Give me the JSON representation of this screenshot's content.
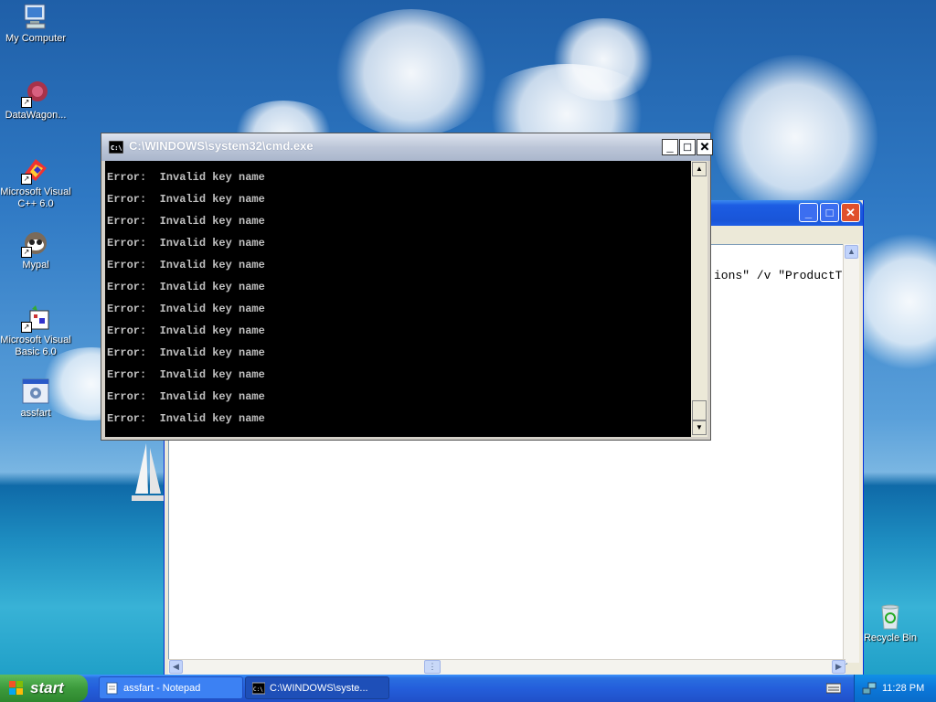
{
  "desktop": {
    "icons": [
      {
        "label": "My Computer"
      },
      {
        "label": "DataWagon..."
      },
      {
        "label": "Microsoft Visual C++ 6.0"
      },
      {
        "label": "Mypal"
      },
      {
        "label": "Microsoft Visual Basic 6.0"
      },
      {
        "label": "assfart"
      },
      {
        "label": "Recycle Bin"
      }
    ]
  },
  "notepad": {
    "visible_text": "ions\" /v \"ProductT"
  },
  "cmd": {
    "title": "C:\\WINDOWS\\system32\\cmd.exe",
    "lines": [
      "Error:  Invalid key name",
      "Error:  Invalid key name",
      "Error:  Invalid key name",
      "Error:  Invalid key name",
      "Error:  Invalid key name",
      "Error:  Invalid key name",
      "Error:  Invalid key name",
      "Error:  Invalid key name",
      "Error:  Invalid key name",
      "Error:  Invalid key name",
      "Error:  Invalid key name",
      "Error:  Invalid key name"
    ]
  },
  "taskbar": {
    "start_label": "start",
    "tasks": [
      {
        "label": "assfart - Notepad",
        "icon": "notepad-icon"
      },
      {
        "label": "C:\\WINDOWS\\syste...",
        "icon": "cmd-icon"
      }
    ],
    "clock": "11:28 PM"
  },
  "colors": {
    "console_bg": "#000000",
    "console_text": "#c0c0c0",
    "taskbar_blue": "#245edb",
    "start_green": "#3c9a3c"
  }
}
